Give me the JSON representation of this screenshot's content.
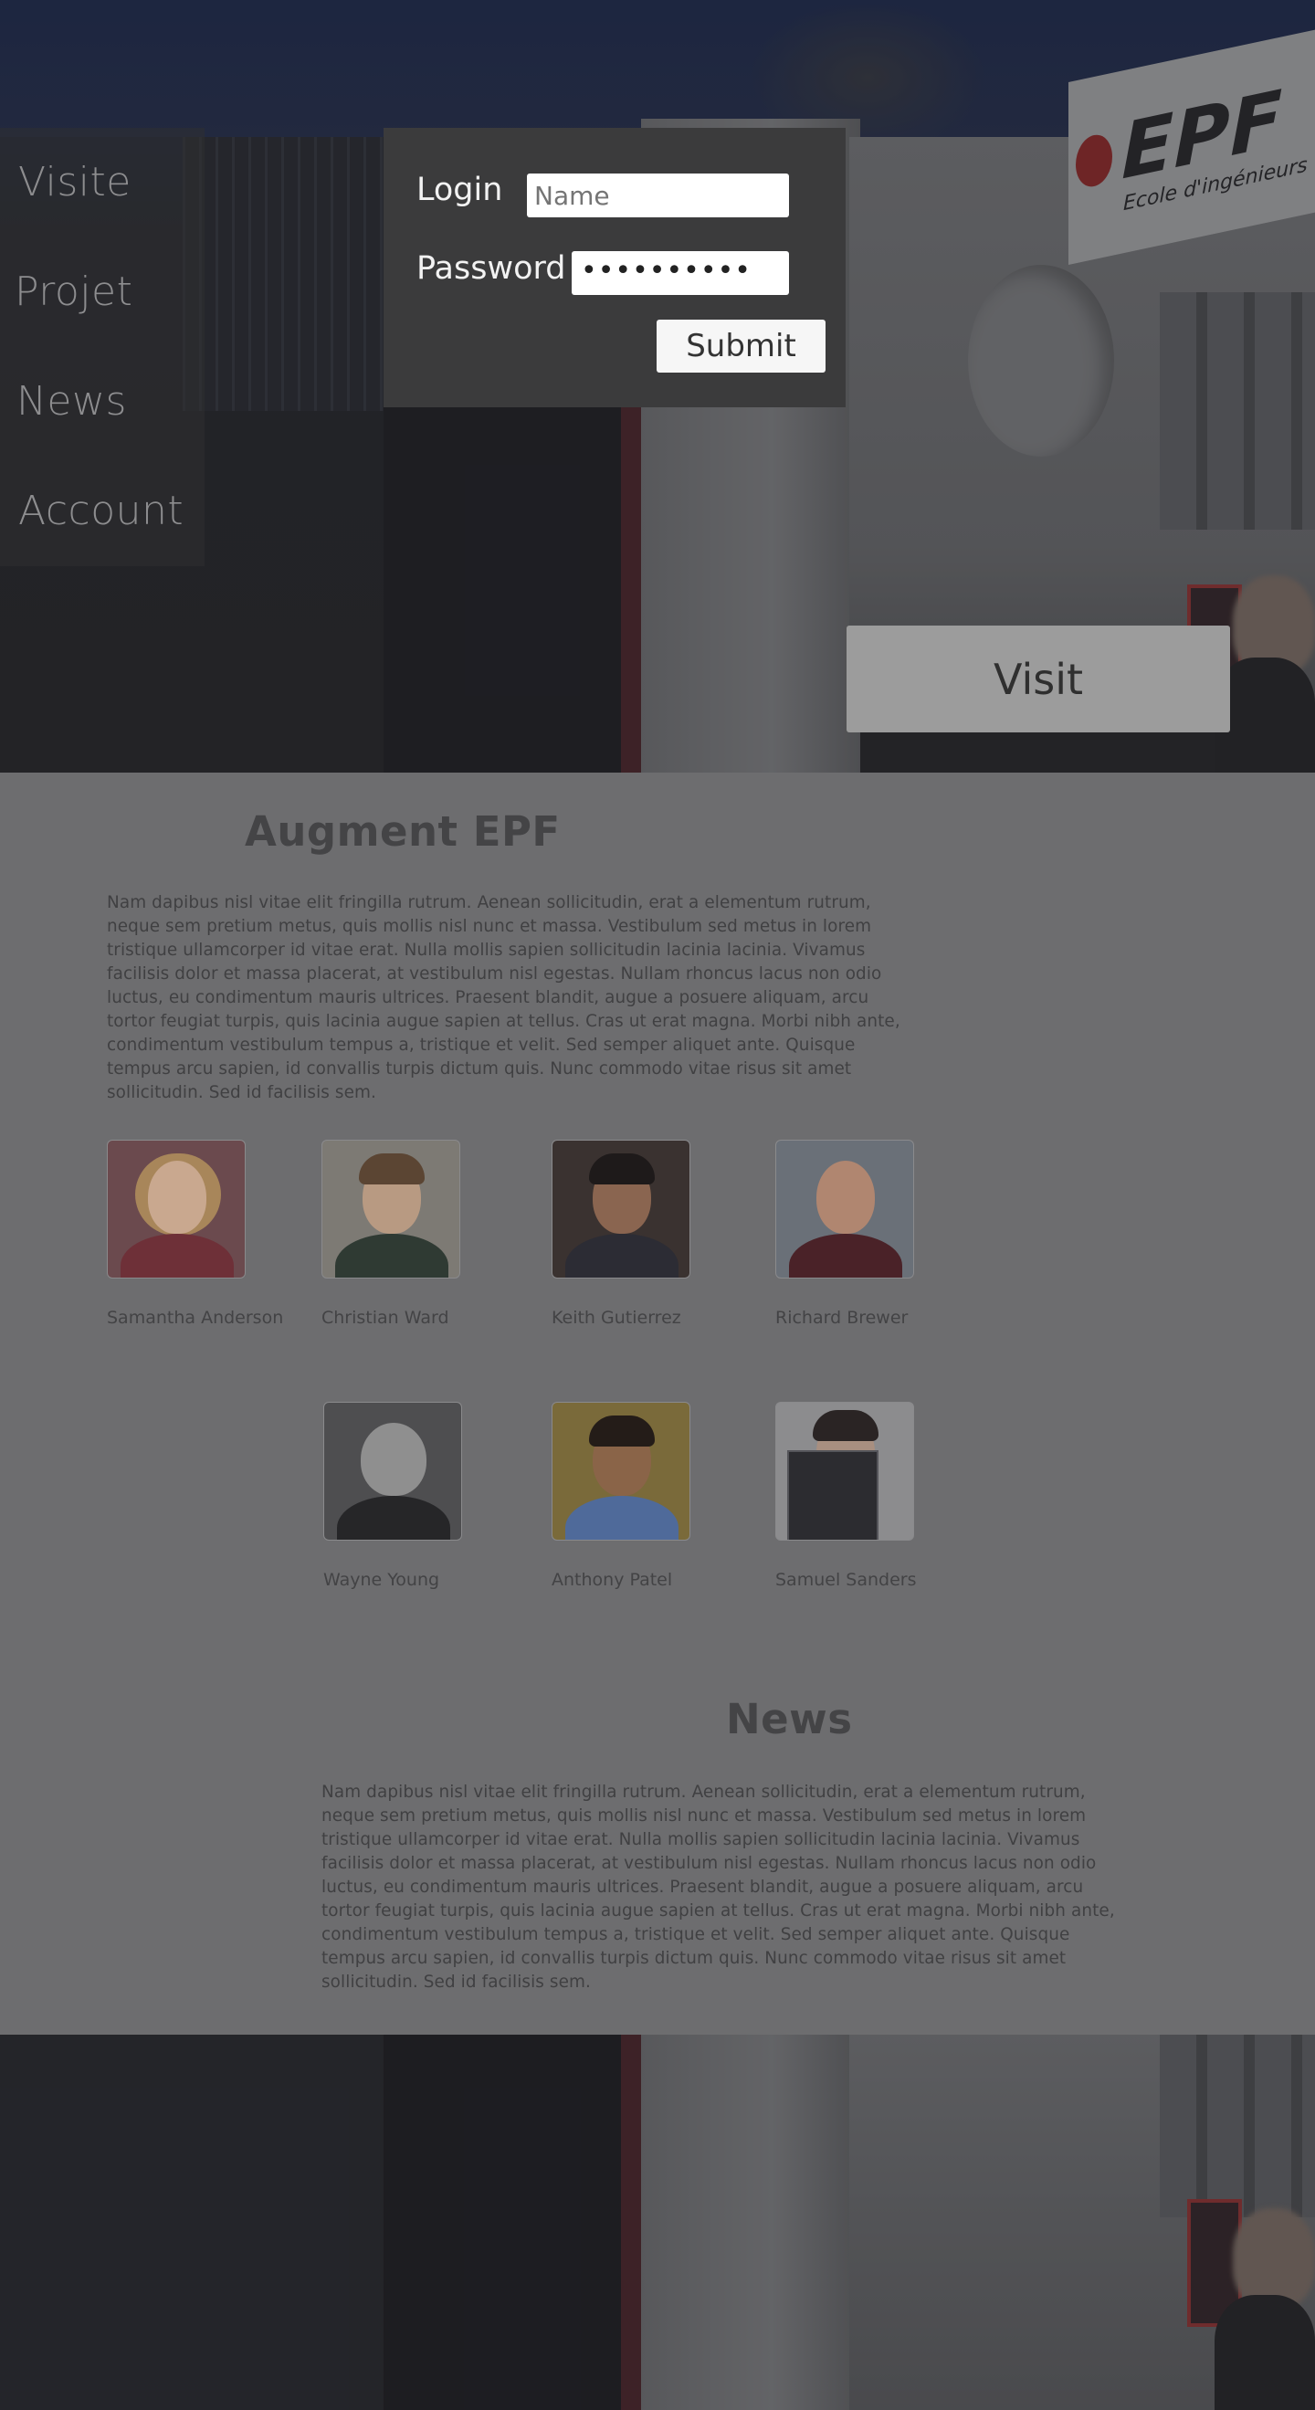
{
  "nav": {
    "items": [
      {
        "label": "Visite"
      },
      {
        "label": "Projet"
      },
      {
        "label": "News"
      },
      {
        "label": "Account"
      }
    ]
  },
  "login": {
    "login_label": "Login",
    "name_placeholder": "Name",
    "name_value": "",
    "password_label": "Password",
    "password_value": "••••••••••",
    "submit_label": "Submit"
  },
  "hero": {
    "sign_text": "EPF",
    "sign_subtext": "Ecole d'ingénieurs",
    "visit_label": "Visit"
  },
  "about": {
    "title": "Augment EPF",
    "text": "Nam dapibus nisl vitae elit fringilla rutrum. Aenean sollicitudin, erat a elementum rutrum, neque sem pretium metus, quis mollis nisl nunc et massa. Vestibulum sed metus in lorem tristique ullamcorper id vitae erat. Nulla mollis sapien sollicitudin lacinia lacinia. Vivamus facilisis dolor et massa placerat, at vestibulum nisl egestas. Nullam rhoncus lacus non odio luctus, eu condimentum mauris ultrices. Praesent blandit, augue a posuere aliquam, arcu tortor feugiat turpis, quis lacinia augue sapien at tellus. Cras ut erat magna. Morbi nibh ante, condimentum vestibulum tempus a, tristique et velit. Sed semper aliquet ante. Quisque tempus arcu sapien, id convallis turpis dictum quis. Nunc commodo vitae risus sit amet sollicitudin. Sed id facilisis sem."
  },
  "team": [
    {
      "name": "Samantha Anderson"
    },
    {
      "name": "Christian Ward"
    },
    {
      "name": "Keith Gutierrez"
    },
    {
      "name": "Richard Brewer"
    },
    {
      "name": "Wayne Young"
    },
    {
      "name": "Anthony Patel"
    },
    {
      "name": "Samuel Sanders"
    }
  ],
  "news": {
    "title": "News",
    "text": "Nam dapibus nisl vitae elit fringilla rutrum. Aenean sollicitudin, erat a elementum rutrum, neque sem pretium metus, quis mollis nisl nunc et massa. Vestibulum sed metus in lorem tristique ullamcorper id vitae erat. Nulla mollis sapien sollicitudin lacinia lacinia. Vivamus facilisis dolor et massa placerat, at vestibulum nisl egestas. Nullam rhoncus lacus non odio luctus, eu condimentum mauris ultrices. Praesent blandit, augue a posuere aliquam, arcu tortor feugiat turpis, quis lacinia augue sapien at tellus. Cras ut erat magna. Morbi nibh ante, condimentum vestibulum tempus a, tristique et velit. Sed semper aliquet ante. Quisque tempus arcu sapien, id convallis turpis dictum quis. Nunc commodo vitae risus sit amet sollicitudin. Sed id facilisis sem."
  },
  "colors": {
    "content_bg": "#6d6d6f",
    "login_panel_bg": "#3b3b3c",
    "visit_button_bg": "#9c9c9c",
    "brand_red": "#c0392b"
  }
}
